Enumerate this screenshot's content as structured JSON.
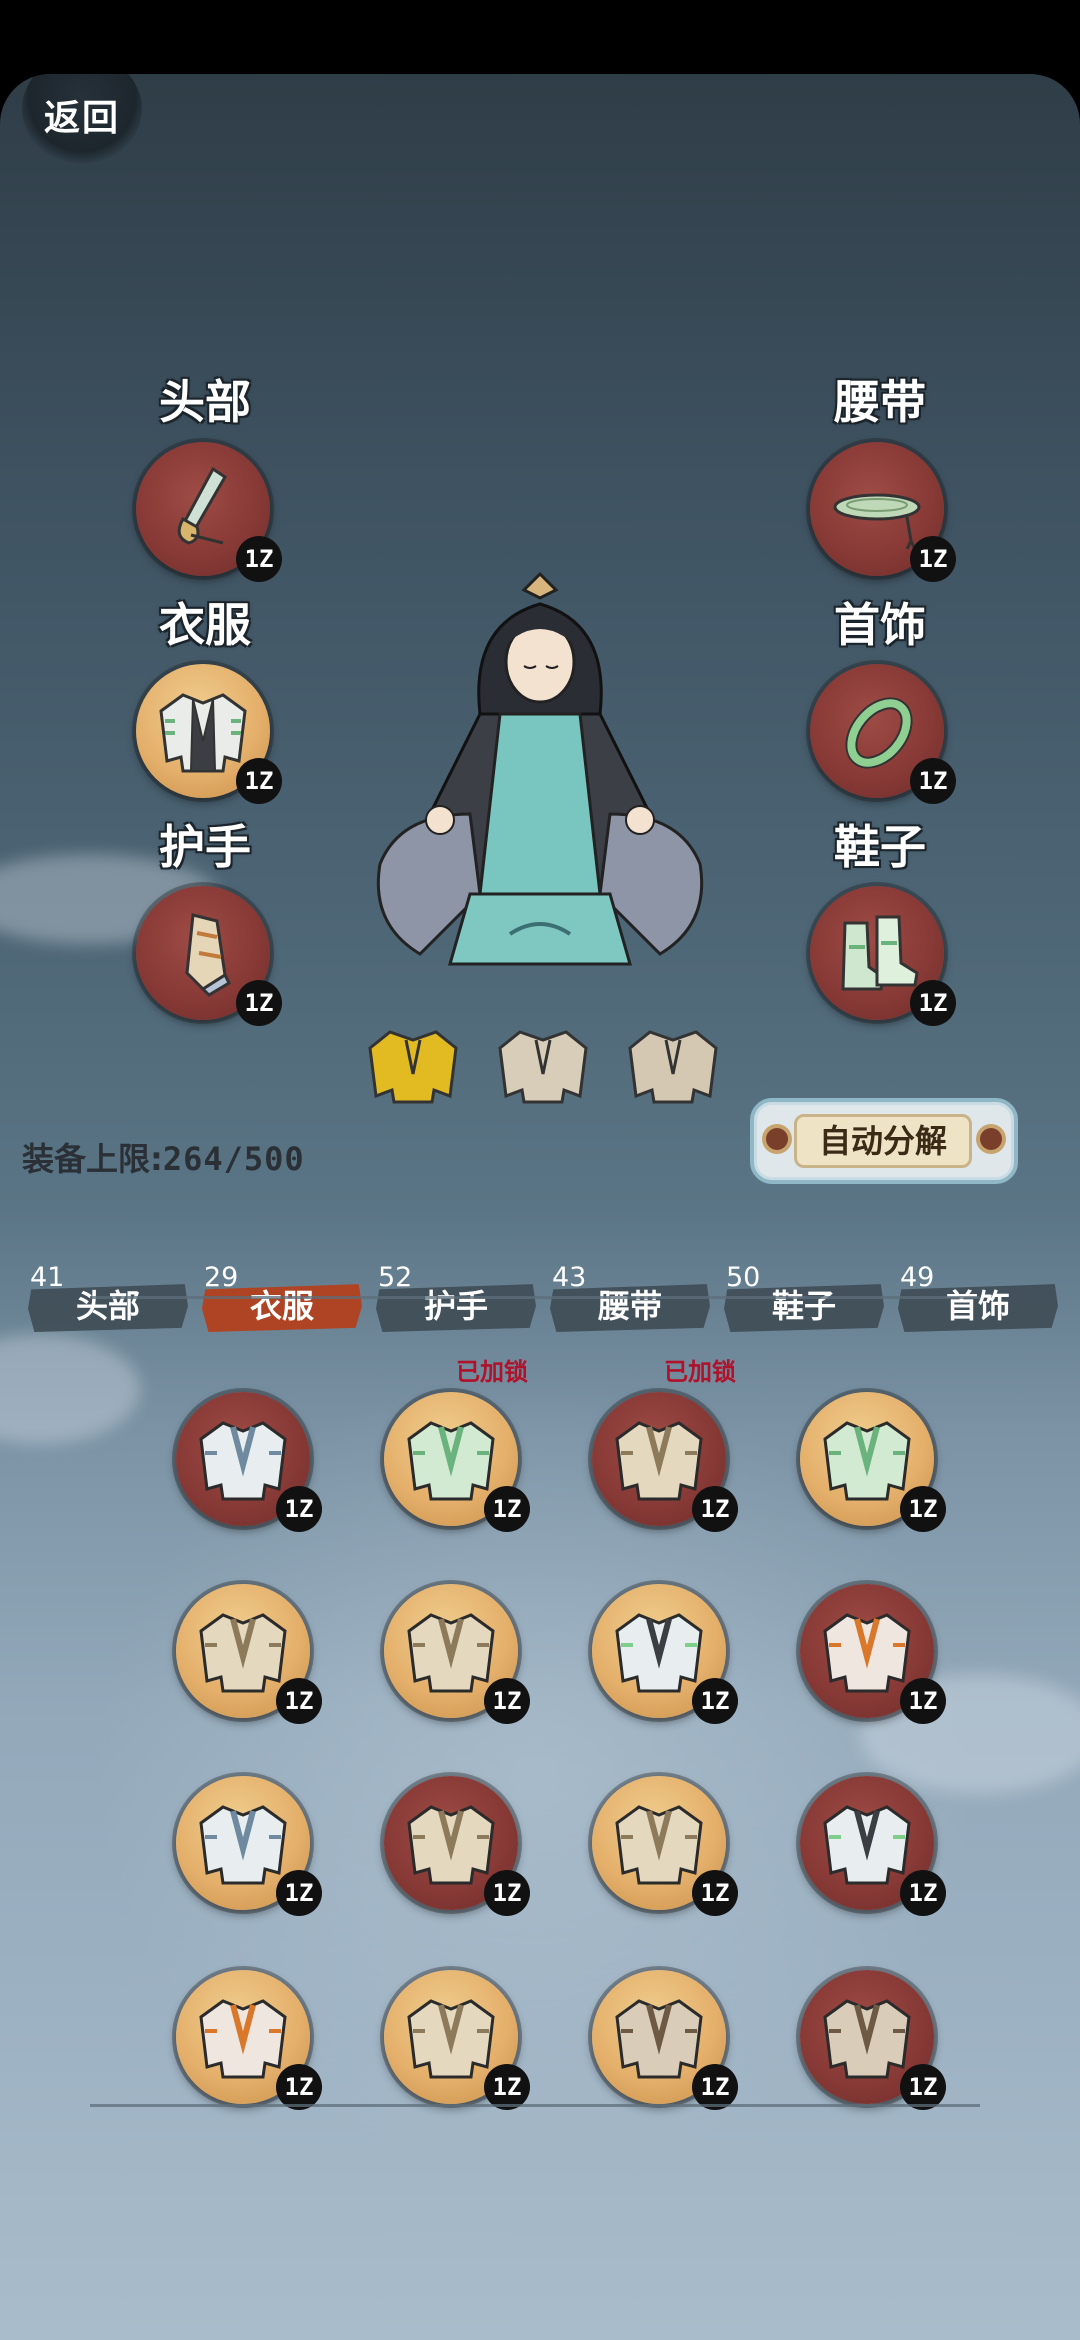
{
  "back_label": "返回",
  "equip_slots": [
    {
      "label": "头部",
      "level": "1Z",
      "color": "red",
      "icon": "hairpin-icon"
    },
    {
      "label": "衣服",
      "level": "1Z",
      "color": "gold",
      "icon": "robe-icon"
    },
    {
      "label": "护手",
      "level": "1Z",
      "color": "red",
      "icon": "bracer-icon"
    },
    {
      "label": "腰带",
      "level": "1Z",
      "color": "red",
      "icon": "belt-icon"
    },
    {
      "label": "首饰",
      "level": "1Z",
      "color": "red",
      "icon": "bracelet-icon"
    },
    {
      "label": "鞋子",
      "level": "1Z",
      "color": "red",
      "icon": "boots-icon"
    }
  ],
  "capacity": {
    "label": "装备上限:",
    "value": "264/500"
  },
  "auto_decompose_label": "自动分解",
  "tabs": [
    {
      "label": "头部",
      "count": "41",
      "active": false
    },
    {
      "label": "衣服",
      "count": "29",
      "active": true
    },
    {
      "label": "护手",
      "count": "52",
      "active": false
    },
    {
      "label": "腰带",
      "count": "43",
      "active": false
    },
    {
      "label": "鞋子",
      "count": "50",
      "active": false
    },
    {
      "label": "首饰",
      "count": "49",
      "active": false
    }
  ],
  "inventory": [
    {
      "level": "1Z",
      "color": "red",
      "robe": "white",
      "locked": ""
    },
    {
      "level": "1Z",
      "color": "gold",
      "robe": "jade",
      "locked": "已加锁"
    },
    {
      "level": "1Z",
      "color": "red",
      "robe": "plain",
      "locked": "已加锁"
    },
    {
      "level": "1Z",
      "color": "gold",
      "robe": "jade",
      "locked": ""
    },
    {
      "level": "1Z",
      "color": "gold",
      "robe": "plain",
      "locked": ""
    },
    {
      "level": "1Z",
      "color": "gold",
      "robe": "plain",
      "locked": ""
    },
    {
      "level": "1Z",
      "color": "gold",
      "robe": "dark",
      "locked": ""
    },
    {
      "level": "1Z",
      "color": "red",
      "robe": "flame",
      "locked": ""
    },
    {
      "level": "1Z",
      "color": "gold",
      "robe": "white",
      "locked": ""
    },
    {
      "level": "1Z",
      "color": "red",
      "robe": "plain",
      "locked": ""
    },
    {
      "level": "1Z",
      "color": "gold",
      "robe": "plain",
      "locked": ""
    },
    {
      "level": "1Z",
      "color": "red",
      "robe": "dark",
      "locked": ""
    },
    {
      "level": "1Z",
      "color": "gold",
      "robe": "flame",
      "locked": ""
    },
    {
      "level": "1Z",
      "color": "gold",
      "robe": "plain",
      "locked": ""
    },
    {
      "level": "1Z",
      "color": "gold",
      "robe": "brown",
      "locked": ""
    },
    {
      "level": "1Z",
      "color": "red",
      "robe": "brown",
      "locked": ""
    }
  ],
  "colors": {
    "tab_active": "#b83b14",
    "lock_text": "#b0122b",
    "medal_red": "#883a36",
    "medal_gold": "#e4b06b"
  }
}
